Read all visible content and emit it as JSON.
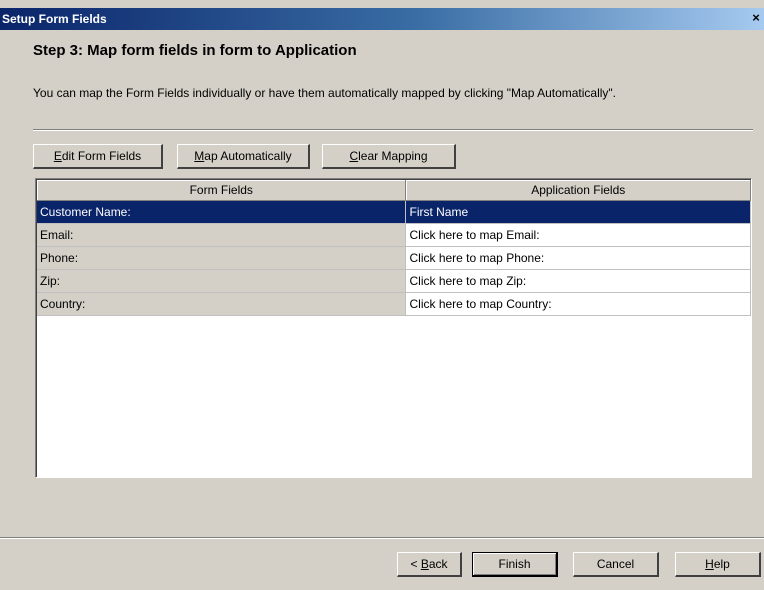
{
  "window": {
    "title": "Setup Form Fields",
    "close_label": "×"
  },
  "step": {
    "title": "Step 3: Map form fields in form to Application",
    "instructions": "You can map the Form Fields individually or have them automatically mapped by clicking \"Map Automatically\"."
  },
  "toolbar": {
    "edit_mnemonic": "E",
    "edit_rest": "dit Form Fields",
    "map_mnemonic": "M",
    "map_rest": "ap Automatically",
    "clear_mnemonic": "C",
    "clear_rest": "lear Mapping"
  },
  "table": {
    "headers": [
      "Form Fields",
      "Application Fields"
    ],
    "rows": [
      {
        "form_field": "Customer Name:",
        "application_field": "First Name",
        "selected": true
      },
      {
        "form_field": "Email:",
        "application_field": "Click here to map Email:",
        "selected": false
      },
      {
        "form_field": "Phone:",
        "application_field": "Click here to map Phone:",
        "selected": false
      },
      {
        "form_field": "Zip:",
        "application_field": "Click here to map Zip:",
        "selected": false
      },
      {
        "form_field": "Country:",
        "application_field": "Click here to map Country:",
        "selected": false
      }
    ]
  },
  "footer": {
    "back_prefix": "< ",
    "back_mnemonic": "B",
    "back_rest": "ack",
    "finish_label": "Finish",
    "cancel_label": "Cancel",
    "help_mnemonic": "H",
    "help_rest": "elp"
  },
  "colors": {
    "titlebar": "#0a246a",
    "selection": "#0a246a",
    "face": "#d4d0c8"
  }
}
